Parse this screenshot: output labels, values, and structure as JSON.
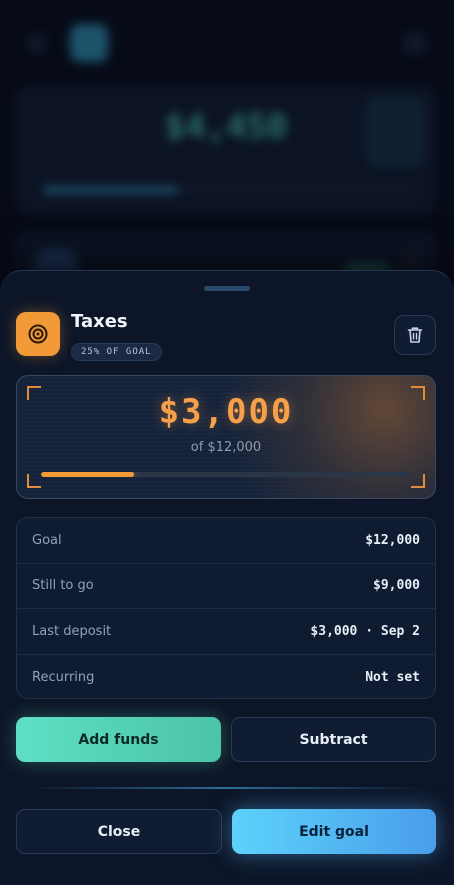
{
  "background": {
    "hero_amount": "$4,450"
  },
  "sheet": {
    "goal": {
      "icon": "target-icon",
      "title": "Taxes",
      "badge": "25% OF GOAL"
    },
    "delete_icon": "trash-icon",
    "hero": {
      "amount": "$3,000",
      "subtitle": "of $12,000",
      "progress": 0.25
    },
    "details": [
      {
        "label": "Goal",
        "value": "$12,000"
      },
      {
        "label": "Still to go",
        "value": "$9,000"
      },
      {
        "label": "Last deposit",
        "value": "$3,000 · Sep 2"
      },
      {
        "label": "Recurring",
        "value": "Not set"
      }
    ],
    "buttons": {
      "add_funds": "Add funds",
      "subtract": "Subtract",
      "close": "Close",
      "edit_goal": "Edit goal"
    }
  },
  "colors": {
    "accent_orange": "#f29a38",
    "accent_teal": "#5fe0c4",
    "accent_blue": "#5cd2fa",
    "sheet_bg": "#0d1628"
  }
}
